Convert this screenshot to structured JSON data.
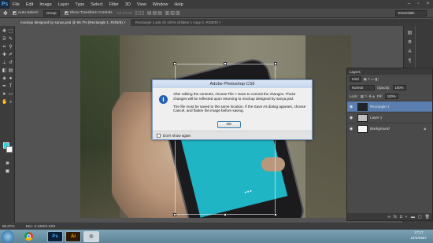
{
  "app": {
    "logo": "Ps",
    "menus": [
      "File",
      "Edit",
      "Image",
      "Layer",
      "Type",
      "Select",
      "Filter",
      "3D",
      "View",
      "Window",
      "Help"
    ]
  },
  "options": {
    "auto_select_label": "Auto-Select:",
    "auto_select_value": "Group",
    "show_transform_label": "Show Transform Controls",
    "workspace": "Essentials"
  },
  "tabs": [
    {
      "label": "mockup designed by sanya.psd @ 66.7% (Rectangle 1, RGB/8) ×"
    },
    {
      "label": "Rectangle 1.psb @ 100% (Ellipse 1 copy 2, RGB/8) ×"
    }
  ],
  "status": {
    "zoom": "66.67%",
    "doc": "Doc: 3.12M/3.12M"
  },
  "layers": {
    "title": "Layers",
    "filter_kind": "Kind",
    "blend_mode": "Normal",
    "opacity_label": "Opacity:",
    "opacity_value": "100%",
    "lock_label": "Lock:",
    "fill_label": "Fill:",
    "fill_value": "100%",
    "items": [
      {
        "name": "Rectangle 1",
        "selected": true
      },
      {
        "name": "Layer 1",
        "selected": false
      },
      {
        "name": "Background",
        "selected": false
      }
    ]
  },
  "dialog": {
    "title": "Adobe Photoshop CS6",
    "message1": "After editing the contents, choose File > Save to commit the changes.  Those changes will be reflected upon returning to mockup designed by sanya.psd.",
    "message2": "The file must be saved to the same location.  If the Save As dialog appears, choose Cancel, and flatten the image before saving.",
    "ok_label": "OK",
    "dont_show_label": "Don't show again"
  },
  "taskbar": {
    "apps": [
      "chrome-icon",
      "photoshop-icon",
      "illustrator-icon",
      "disk-icon"
    ],
    "ps_label": "Ps",
    "ai_label": "Ai",
    "time": "17:17",
    "date": "24/4/2557"
  },
  "colors": {
    "foreground": "#2fd2d8",
    "background": "#ffffff",
    "phone_screen": "#1fb5c4"
  }
}
